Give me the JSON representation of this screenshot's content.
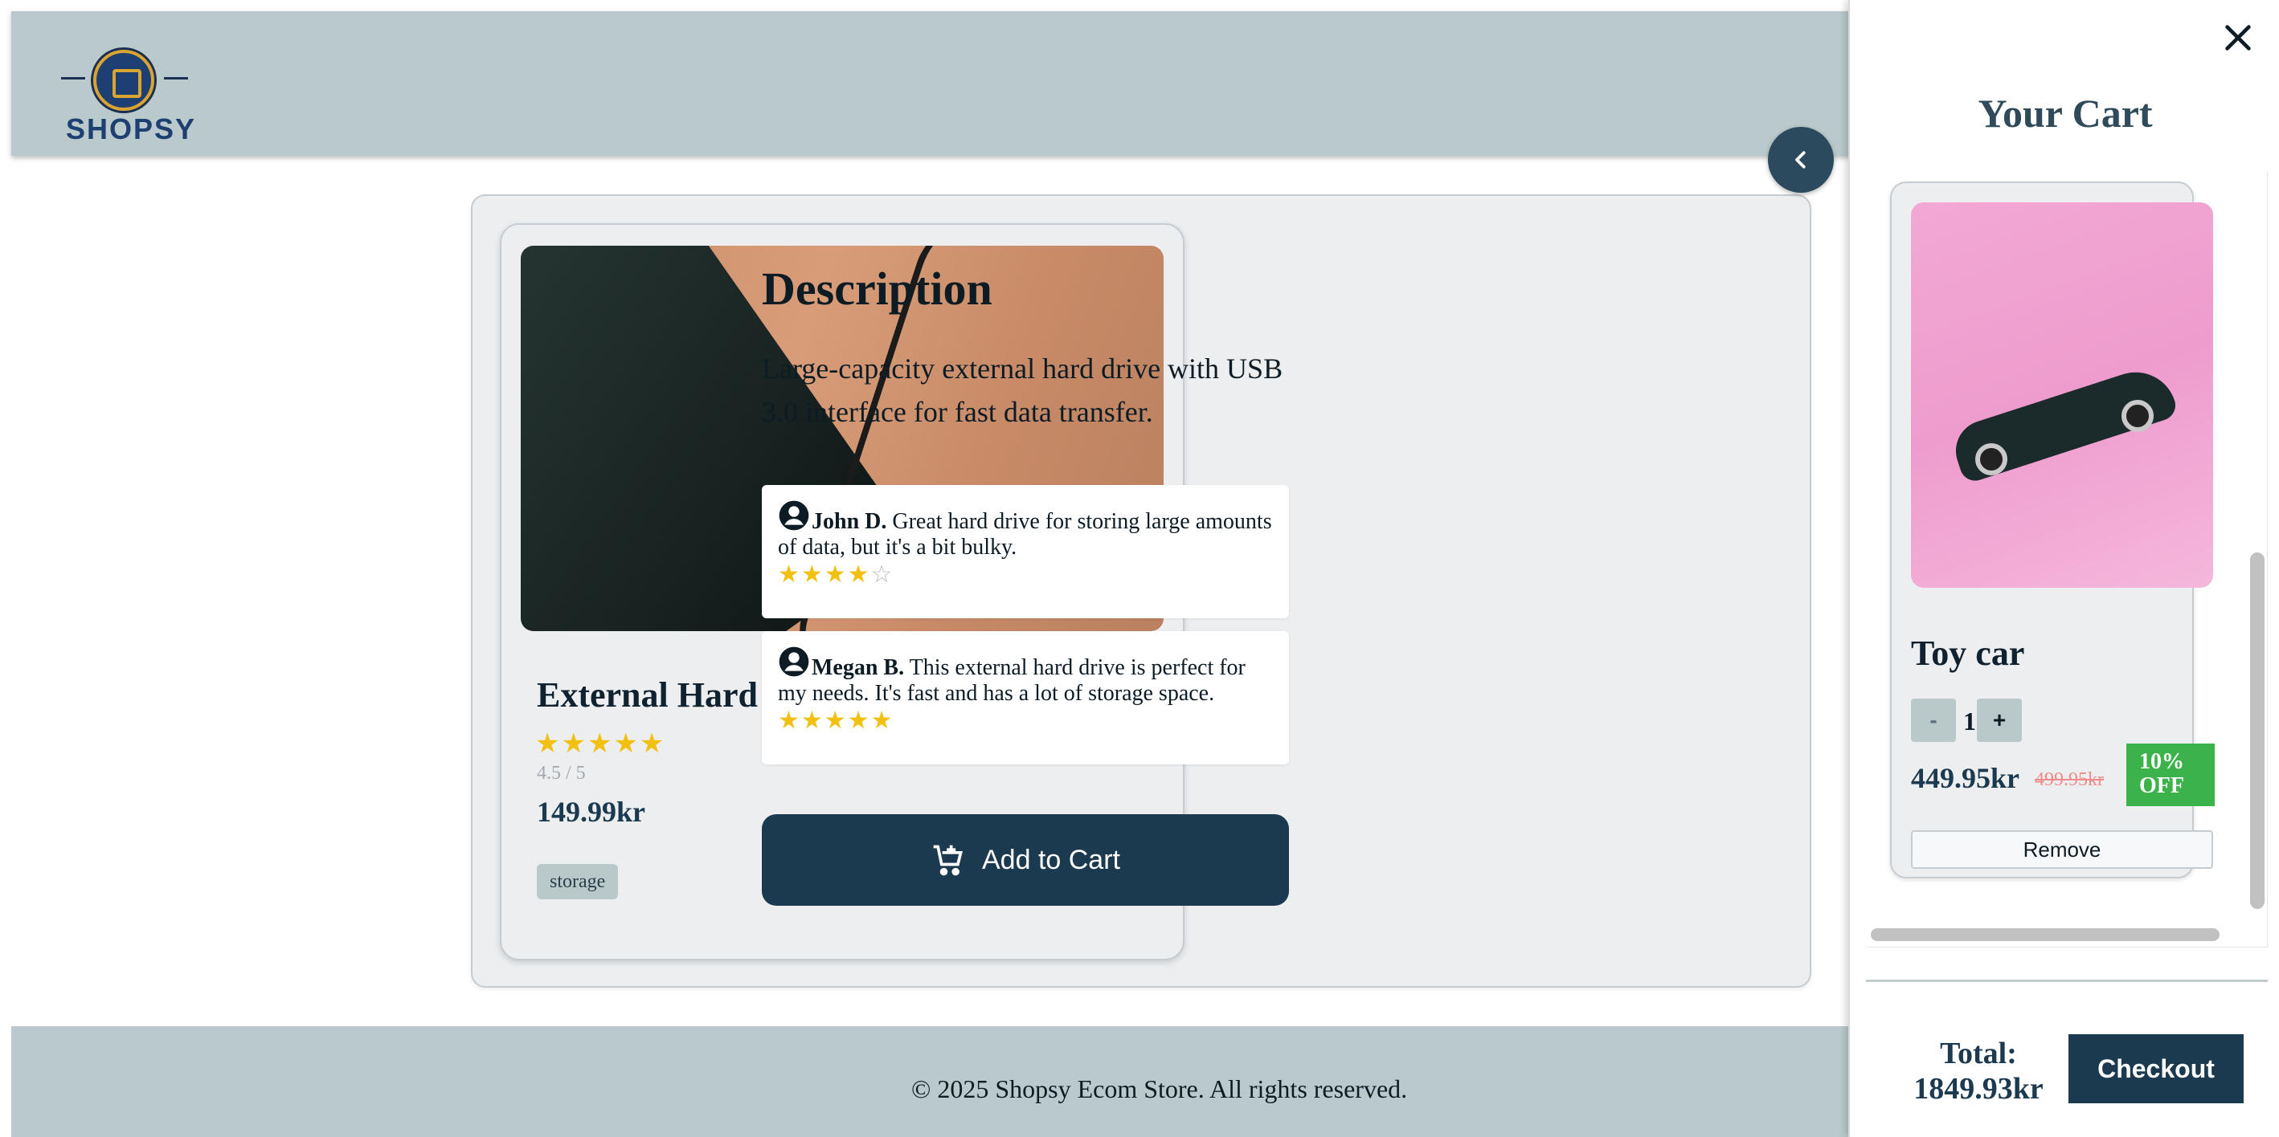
{
  "header": {
    "logo_text": "SHOPSY",
    "logo_icon": "shopping-bag-icon"
  },
  "product": {
    "name": "External Hard Drive",
    "rating_stars": "★★★★★",
    "rating": 4.5,
    "rating_text": "4.5 / 5",
    "price": "149.99kr",
    "tag": "storage",
    "description_title": "Description",
    "description": "Large-capacity external hard drive with USB 3.0 interface for fast data transfer.",
    "add_to_cart_label": "Add to Cart"
  },
  "reviews": [
    {
      "name": "John D.",
      "text": "Great hard drive for storing large amounts of data, but it's a bit bulky.",
      "stars_filled": "★★★★",
      "stars_empty": "☆",
      "rating": 4
    },
    {
      "name": "Megan B.",
      "text": "This external hard drive is perfect for my needs. It's fast and has a lot of storage space.",
      "stars_filled": "★★★★★",
      "stars_empty": "",
      "rating": 5
    }
  ],
  "footer": {
    "text": "© 2025 Shopsy Ecom Store. All rights reserved."
  },
  "cart": {
    "title": "Your Cart",
    "items": [
      {
        "name": "Toy car",
        "quantity": "1",
        "minus_label": "-",
        "plus_label": "+",
        "price": "449.95kr",
        "old_price": "499.95kr",
        "discount": "10% OFF",
        "remove_label": "Remove"
      }
    ],
    "total_label": "Total:",
    "total_value": "1849.93kr",
    "checkout_label": "Checkout"
  },
  "colors": {
    "primary": "#1c3a4f",
    "header_bg": "#bac9cb",
    "star": "#f2c011",
    "discount": "#3cb34a",
    "old_price": "#ee8b8b"
  }
}
